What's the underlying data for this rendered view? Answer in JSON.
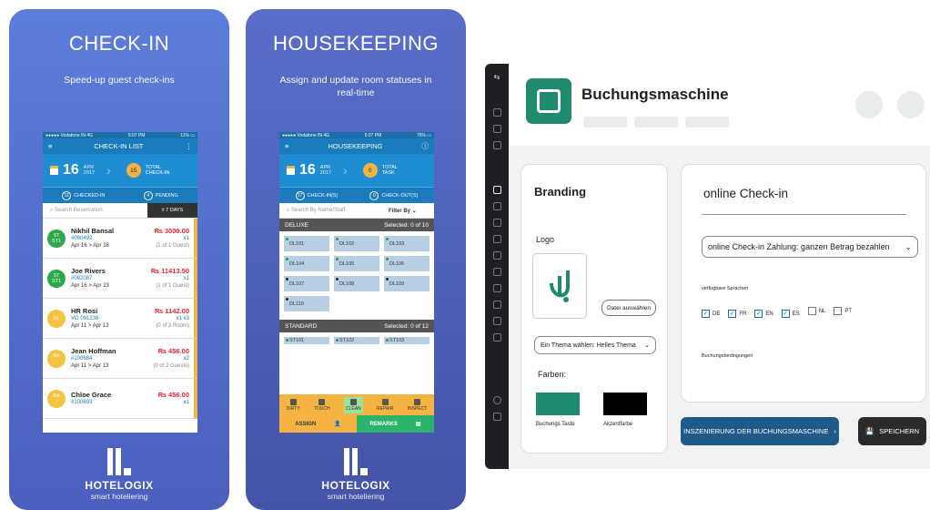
{
  "checkin": {
    "title": "CHECK-IN",
    "subtitle": "Speed-up guest check-ins",
    "status": {
      "left": "●●●●● Vodafone IN  4G",
      "mid": "5:07 PM",
      "right": "11% ▭"
    },
    "appbar": "CHECK-IN LIST",
    "day": "16",
    "month": "APR",
    "year": "2017",
    "total": "15",
    "total_label1": "TOTAL",
    "total_label2": "CHECK-IN",
    "checked_count": "11",
    "checked_label": "CHECKED-IN",
    "pending_count": "4",
    "pending_label": "PENDING",
    "search_placeholder": "Search Reservation",
    "range": "± 7 DAYS",
    "guests": [
      {
        "init": "ST\nST1",
        "name": "Nikhil Bansal",
        "id": "#090492",
        "dates": "Apr 16 > Apr 18",
        "amt": "₨ 3000.00",
        "count": "x1",
        "guests": "(1 of 1 Guest)",
        "color": "#2aa84a"
      },
      {
        "init": "ST\nST1",
        "name": "Joe Rivers",
        "id": "#082087",
        "dates": "Apr 16 > Apr 23",
        "amt": "₨ 11413.50",
        "count": "x1",
        "guests": "(1 of 1 Guest)",
        "color": "#2aa84a"
      },
      {
        "init": "DL",
        "name": "HR Rosi",
        "id": "VG 091236",
        "dates": "Apr 11 > Apr 13",
        "amt": "₨ 1142.00",
        "count": "x1 x3",
        "guests": "(0 of 3 Room)",
        "color": "#f5c342"
      },
      {
        "init": "BA\n-",
        "name": "Jean Hoffman",
        "id": "#100684",
        "dates": "Apr 11 > Apr 13",
        "amt": "₨ 456.00",
        "count": "x2",
        "guests": "(0 of 2 Guests)",
        "color": "#f5c342"
      },
      {
        "init": "BA\n-",
        "name": "Chloe Grace",
        "id": "#100693",
        "dates": "",
        "amt": "₨ 456.00",
        "count": "x1",
        "guests": "",
        "color": "#f5c342"
      }
    ]
  },
  "housekeeping": {
    "title": "HOUSEKEEPING",
    "subtitle": "Assign and update room statuses in real-time",
    "status": {
      "left": "●●●●● Vodafone IN  4G",
      "mid": "5:07 PM",
      "right": "76% ▭"
    },
    "appbar": "HOUSEKEEPING",
    "day": "16",
    "month": "APR",
    "year": "2017",
    "task": "0",
    "task_label1": "TOTAL",
    "task_label2": "TASK",
    "checkin_count": "17",
    "checkin_label": "CHECK-IN(S)",
    "checkout_count": "0",
    "checkout_label": "CHECK-OUT(S)",
    "search_placeholder": "Search By Name/Staff",
    "filter": "Filter By",
    "sec1": "DELUXE",
    "sec1_sel": "Selected: 0 of 10",
    "sec2": "STANDARD",
    "sec2_sel": "Selected: 0 of 12",
    "rooms": [
      "DL101",
      "DL102",
      "DL103",
      "DL104",
      "DL105",
      "DL106",
      "DL107",
      "DL108",
      "DL109",
      "DL110"
    ],
    "std_rooms": [
      "ST101",
      "ST102",
      "ST103"
    ],
    "actions": [
      "DIRTY",
      "TOUCH",
      "CLEAN",
      "REPAIR",
      "INSPECT"
    ],
    "assign": "ASSIGN",
    "remarks": "REMARKS"
  },
  "brand": {
    "name": "HOTELOGIX",
    "tagline": "smart hoteliering"
  },
  "bm": {
    "title": "Buchungsmaschine",
    "branding": "Branding",
    "logo": "Logo",
    "upload": "Datei auswählen",
    "theme": "Ein Thema wählen: Helles Thema",
    "colors": "Farben:",
    "sw1": "Buchungs Taste",
    "sw2": "Akzentfarbe",
    "sw1_color": "#1f8a6d",
    "sw2_color": "#000000",
    "online": "online Check-in",
    "payment": "online Check-in Zahlung: ganzen Betrag bezahlen",
    "langs_label": "verfügbare Sprachen",
    "langs": [
      {
        "code": "DE",
        "on": true
      },
      {
        "code": "FR",
        "on": true
      },
      {
        "code": "EN",
        "on": true
      },
      {
        "code": "ES",
        "on": true
      },
      {
        "code": "NL",
        "on": false
      },
      {
        "code": "PT",
        "on": false
      }
    ],
    "terms": "Buchungsbedingungen",
    "preview": "INSZENIERUNG DER BUCHUNGSMASCHINE",
    "save": "SPEICHERN"
  }
}
